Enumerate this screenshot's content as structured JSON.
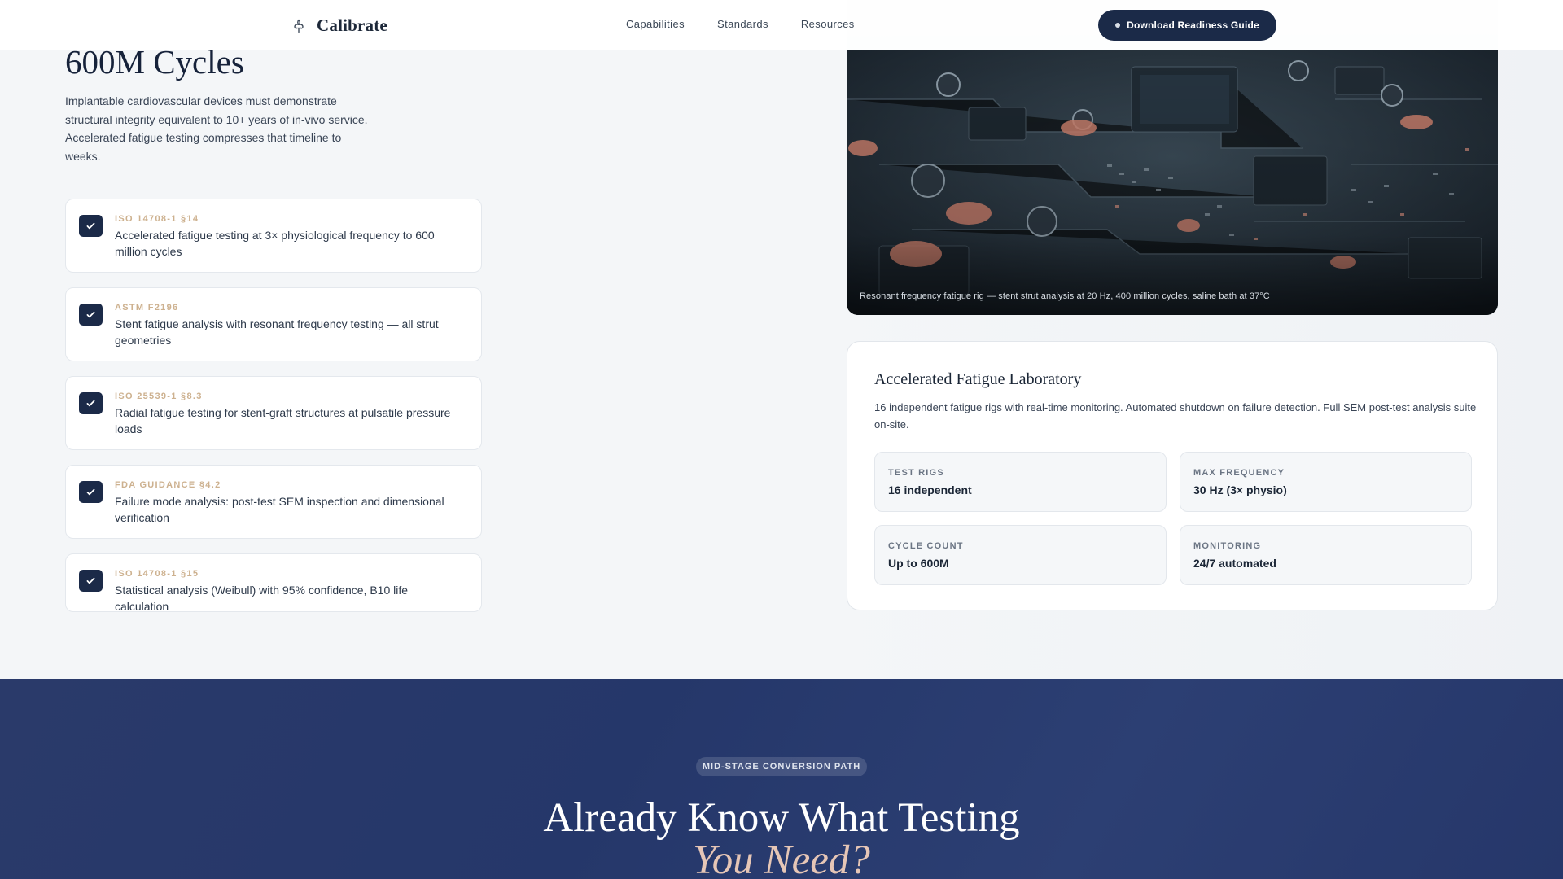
{
  "nav": {
    "brand": "Calibrate",
    "brand_icon": "fleur-de-lis-icon",
    "links": [
      "Capabilities",
      "Standards",
      "Resources"
    ],
    "cta": "Download Readiness Guide"
  },
  "hero": {
    "title": "600M Cycles",
    "description": "Implantable cardiovascular devices must demonstrate structural integrity equivalent to 10+ years of in-vivo service. Accelerated fatigue testing compresses that timeline to weeks."
  },
  "standards": [
    {
      "code": "ISO 14708-1 §14",
      "text": "Accelerated fatigue testing at 3× physiological frequency to 600 million cycles"
    },
    {
      "code": "ASTM F2196",
      "text": "Stent fatigue analysis with resonant frequency testing — all strut geometries"
    },
    {
      "code": "ISO 25539-1 §8.3",
      "text": "Radial fatigue testing for stent-graft structures at pulsatile pressure loads"
    },
    {
      "code": "FDA GUIDANCE §4.2",
      "text": "Failure mode analysis: post-test SEM inspection and dimensional verification"
    },
    {
      "code": "ISO 14708-1 §15",
      "text": "Statistical analysis (Weibull) with 95% confidence, B10 life calculation"
    }
  ],
  "photo": {
    "caption": "Resonant frequency fatigue rig — stent strut analysis at 20 Hz, 400 million cycles, saline bath at 37°C"
  },
  "lab": {
    "title": "Accelerated Fatigue Laboratory",
    "description": "16 independent fatigue rigs with real-time monitoring. Automated shutdown on failure detection. Full SEM post-test analysis suite on-site.",
    "stats": [
      {
        "label": "TEST RIGS",
        "value": "16 independent"
      },
      {
        "label": "MAX FREQUENCY",
        "value": "30 Hz (3× physio)"
      },
      {
        "label": "CYCLE COUNT",
        "value": "Up to 600M"
      },
      {
        "label": "MONITORING",
        "value": "24/7 automated"
      }
    ]
  },
  "conversion": {
    "pill": "MID-STAGE CONVERSION PATH",
    "title": "Already Know What Testing",
    "subtitle": "You Need?"
  },
  "colors": {
    "primary": "#1b2a48",
    "accent_code": "#cdb18f",
    "bottom_bg": "#27386b",
    "subtitle_accent": "#e6c6b6"
  }
}
